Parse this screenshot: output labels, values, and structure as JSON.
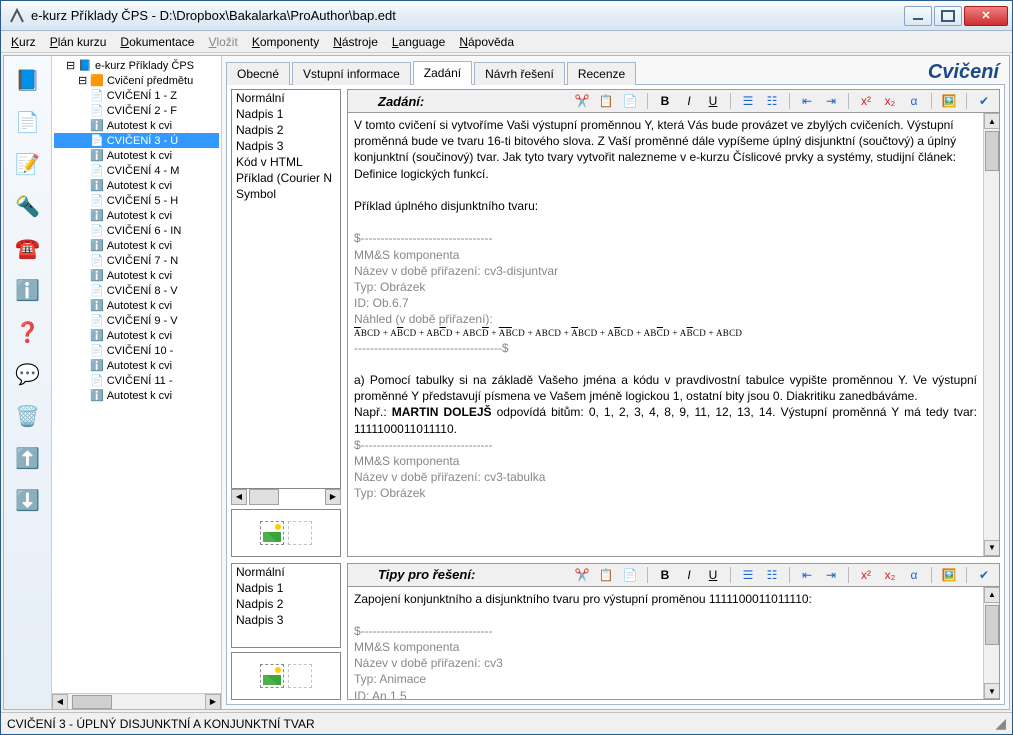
{
  "window": {
    "title": "e-kurz Příklady ČPS - D:\\Dropbox\\Bakalarka\\ProAuthor\\bap.edt"
  },
  "menubar": [
    "Kurz",
    "Plán kurzu",
    "Dokumentace",
    "Vložit",
    "Komponenty",
    "Nástroje",
    "Language",
    "Nápověda"
  ],
  "left_icons": [
    "📘",
    "📄",
    "📝",
    "🔦",
    "☎️",
    "ℹ️",
    "❓",
    "💬",
    "🗑️",
    "⬆️",
    "⬇️"
  ],
  "tree": {
    "root": "e-kurz Příklady ČPS",
    "sub": "Cvičení předmětu",
    "items": [
      "CVIČENÍ 1 - Z",
      "CVIČENÍ 2 - F",
      "Autotest k cvi",
      "CVIČENÍ 3 - Ú",
      "Autotest k cvi",
      "CVIČENÍ 4 - M",
      "Autotest k cvi",
      "CVIČENÍ 5 - H",
      "Autotest k cvi",
      "CVIČENÍ 6 - IN",
      "Autotest k cvi",
      "CVIČENÍ 7 - N",
      "Autotest k cvi",
      "CVIČENÍ 8 - V",
      "Autotest k cvi",
      "CVIČENÍ 9 - V",
      "Autotest k cvi",
      "CVIČENÍ 10 -",
      "Autotest k cvi",
      "CVIČENÍ 11 -",
      "Autotest k cvi"
    ],
    "selected_index": 3
  },
  "top_tabs": [
    "Obecné",
    "Vstupní informace",
    "Zadání",
    "Návrh řešení",
    "Recenze"
  ],
  "active_tab": 2,
  "brand": "Cvičení",
  "styles": [
    "Normální",
    "Nadpis 1",
    "Nadpis 2",
    "Nadpis 3",
    "Kód v HTML",
    "Příklad (Courier N",
    "Symbol"
  ],
  "styles2": [
    "Normální",
    "Nadpis 1",
    "Nadpis 2",
    "Nadpis 3"
  ],
  "zadani": {
    "heading": "Zadání:",
    "p1": "V tomto cvičení si vytvoříme Vaši výstupní proměnnou Y, která Vás bude provázet ve zbylých cvičeních. Výstupní proměnná bude ve tvaru 16-ti bitového slova. Z Vaší proměnné dále vypíšeme úplný disjunktní (součtový) a úplný konjunktní (součinový) tvar. Jak tyto tvary vytvořit nalezneme v e-kurzu Číslicové prvky a systémy, studijní článek: Definice logických funkcí.",
    "p2": "Příklad úplného disjunktního tvaru:",
    "meta1": {
      "sep": "$---------------------------------",
      "l1": "MM&S komponenta",
      "l2": "Název v době přiřazení: cv3-disjuntvar",
      "l3": "Typ: Obrázek",
      "l4": "ID: Ob.6.7",
      "l5": "Náhled (v době přiřazení):",
      "l6": "-------------------------------------$"
    },
    "formula": "ĀBCD + AB̄CD + ABC̄D + ABCD̄ + ĀB̄CD + ABCD + ĀBCD + AB̄CD + ABC̄D + AB̄CD + ABCD",
    "p3a": "a) Pomocí tabulky si na základě Vašeho jména a kódu v pravdivostní tabulce vypište proměnnou Y. Ve výstupní proměnné Y představují písmena ve Vašem jméně logickou 1, ostatní bity jsou 0. Diakritiku zanedbáváme.",
    "p3b_pre": "Např.: ",
    "p3b_bold": "MARTIN DOLEJŠ",
    "p3b_post": " odpovídá bitům: 0, 1, 2, 3, 4, 8, 9, 11, 12, 13, 14. Výstupní proměnná Y má tedy tvar: 1111100011011110.",
    "meta2": {
      "sep": "$---------------------------------",
      "l1": "MM&S komponenta",
      "l2": "Název v době přiřazení: cv3-tabulka",
      "l3": "Typ: Obrázek"
    }
  },
  "tipy": {
    "heading": "Tipy pro řešení:",
    "p1": "Zapojení konjunktního a disjunktního tvaru pro výstupní proměnou 1111100011011110:",
    "meta": {
      "sep": "$---------------------------------",
      "l1": "MM&S komponenta",
      "l2": "Název v době přiřazení: cv3",
      "l3": "Typ: Animace",
      "l4": "ID: An.1.5"
    }
  },
  "status": "CVIČENÍ 3 - ÚPLNÝ DISJUNKTNÍ A KONJUNKTNÍ TVAR"
}
